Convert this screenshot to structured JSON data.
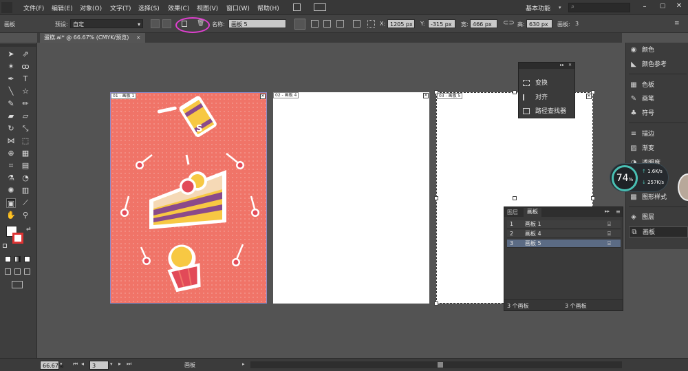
{
  "menubar": {
    "items": [
      "文件(F)",
      "编辑(E)",
      "对象(O)",
      "文字(T)",
      "选择(S)",
      "效果(C)",
      "视图(V)",
      "窗口(W)",
      "帮助(H)"
    ],
    "workspace": "基本功能",
    "search_placeholder": ""
  },
  "control_bar": {
    "panel_label": "画板",
    "preset_label": "预设:",
    "preset_value": "自定",
    "name_label": "名称:",
    "name_value": "画板 5",
    "x_label": "X:",
    "x_value": "1205 px",
    "y_label": "Y:",
    "y_value": "-315 px",
    "w_label": "宽:",
    "w_value": "466 px",
    "h_label": "高:",
    "h_value": "630 px",
    "count_label": "画板:",
    "count_value": "3",
    "highlight_color": "#e040d0"
  },
  "document": {
    "tab_title": "蛋糕.ai* @ 66.67% (CMYK/预览)",
    "close_glyph": "×"
  },
  "artboards": [
    {
      "label": "01 - 画板 1",
      "background": "#f07468"
    },
    {
      "label": "02 - 画板 4",
      "background": "#ffffff"
    },
    {
      "label": "03 - 画板 5",
      "background": "#ffffff"
    }
  ],
  "artwork": {
    "cup_letter": "S"
  },
  "float_panel": {
    "items": [
      "变换",
      "对齐",
      "路径查找器"
    ]
  },
  "right_panel": {
    "items": [
      "颜色",
      "颜色参考",
      "色板",
      "画笔",
      "符号",
      "描边",
      "渐变",
      "透明度",
      "图形样式",
      "图层",
      "画板"
    ]
  },
  "artboards_panel": {
    "tabs": [
      "图层",
      "画板"
    ],
    "rows": [
      {
        "num": "1",
        "name": "画板 1"
      },
      {
        "num": "2",
        "name": "画板 4"
      },
      {
        "num": "3",
        "name": "画板 5"
      }
    ],
    "footer": "3 个画板"
  },
  "net_widget": {
    "percent": "74",
    "percent_unit": "%",
    "up": "1.6K/s",
    "down": "257K/s"
  },
  "status_bar": {
    "zoom": "66.67%",
    "artboard_num": "3",
    "tool_label": "画板"
  }
}
